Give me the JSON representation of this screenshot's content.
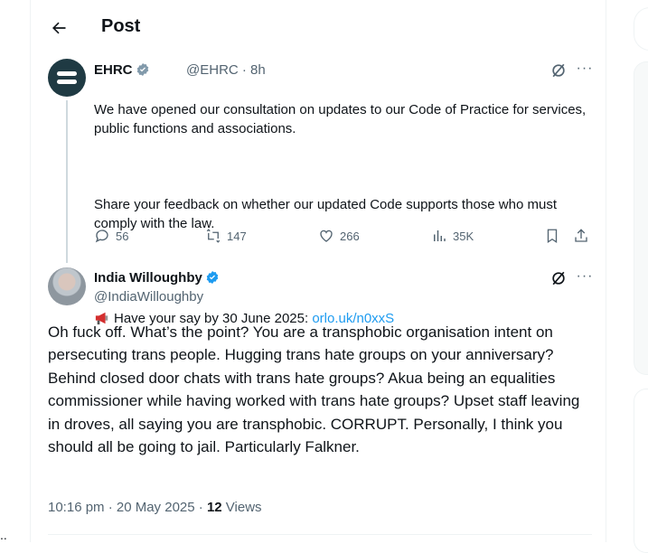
{
  "header": {
    "title": "Post"
  },
  "parent_post": {
    "author_name": "EHRC",
    "author_handle": "@EHRC",
    "time": "8h",
    "handle_time": "@EHRC · 8h",
    "text_para1": "We have opened our consultation on updates to our Code of Practice for services, public functions and associations.",
    "text_para2": "Share your feedback on whether our updated Code supports those who must comply with the law.",
    "text_cta": "Have your say by 30 June 2025: ",
    "link": "orlo.uk/n0xxS",
    "replies": "56",
    "reposts": "147",
    "likes": "266",
    "views": "35K"
  },
  "main_post": {
    "author_name": "India Willoughby",
    "author_handle": "@IndiaWilloughby",
    "text": "Oh fuck off. What’s the point? You are a transphobic organisation intent on persecuting trans people. Hugging trans hate groups on your anniversary? Behind closed door chats with trans hate groups? Akua being an equalities commissioner while having worked with trans hate groups? Upset staff leaving in droves, all saying you are transphobic. CORRUPT. Personally, I think you should all be going to jail. Particularly Falkner.",
    "timestamp": "10:16 pm · 20 May 2025 · ",
    "views_count": "12",
    "views_label": " Views"
  },
  "icons": {
    "back": "arrow-left-icon",
    "verified": "verified-badge-icon",
    "grok": "grok-icon",
    "more": "more-icon",
    "megaphone": "megaphone-icon",
    "reply": "reply-icon",
    "repost": "repost-icon",
    "like": "like-icon",
    "views": "views-icon",
    "bookmark": "bookmark-icon",
    "share": "share-icon"
  },
  "colors": {
    "link": "#1d9bf0",
    "verified": "#1d9bf0",
    "secondary_text": "#536471",
    "ehrc_avatar": "#1f3a43"
  },
  "misc": {
    "left_edge_text": ".."
  }
}
